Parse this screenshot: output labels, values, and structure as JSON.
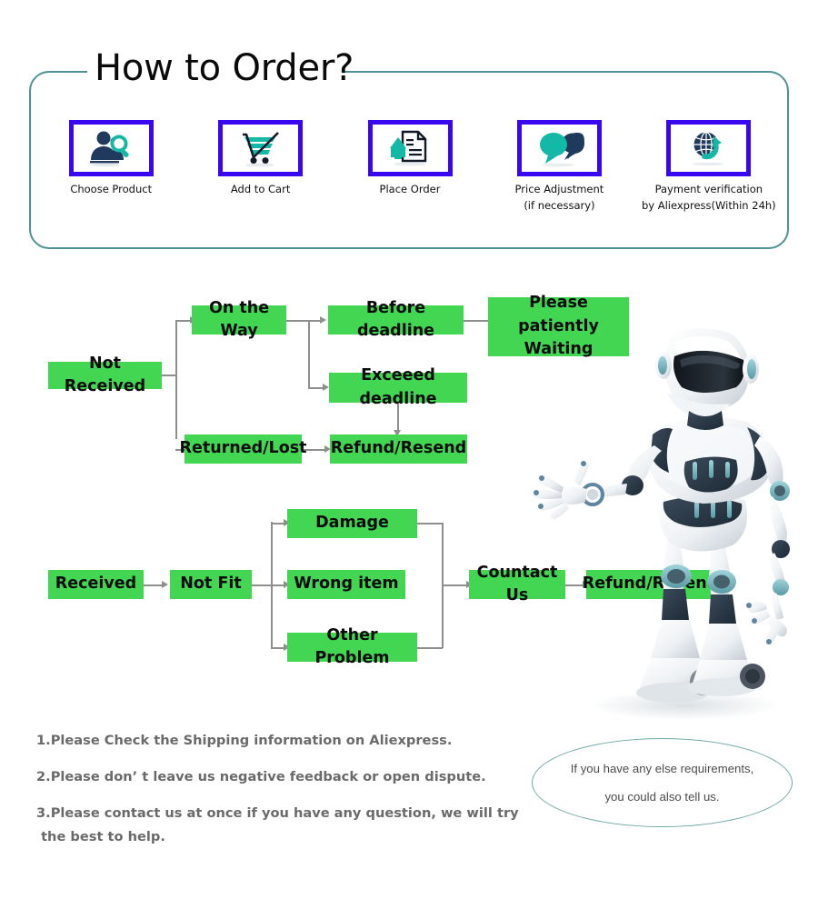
{
  "theme": {
    "frame_teal": "#4f9194",
    "icon_border_blue": "#3a05ef",
    "flow_green": "#43d653",
    "connector_gray": "#8e8e8e",
    "note_gray": "#6a6a6a",
    "icon_teal": "#14b8a6",
    "icon_navy": "#1f3a5c"
  },
  "header": {
    "title": "How to Order?"
  },
  "steps": [
    {
      "icon": "person-search-icon",
      "label": "Choose  Product",
      "sub": ""
    },
    {
      "icon": "shopping-cart-icon",
      "label": "Add to Cart",
      "sub": ""
    },
    {
      "icon": "document-upload-icon",
      "label": "Place  Order",
      "sub": ""
    },
    {
      "icon": "speech-bubbles-icon",
      "label": "Price Adjustment",
      "sub": "(if necessary)"
    },
    {
      "icon": "globe-refresh-icon",
      "label": "Payment verification",
      "sub": "by Aliexpress(Within 24h)"
    }
  ],
  "flow_not_received": {
    "boxes": {
      "not_received": "Not Received",
      "on_the_way": "On the Way",
      "before_deadline": "Before deadline",
      "please_wait": "Please patiently\nWaiting",
      "exceed_deadline": "Exceeed deadline",
      "returned_lost": "Returned/Lost",
      "refund_resend": "Refund/Resend"
    }
  },
  "flow_received": {
    "boxes": {
      "received": "Received",
      "not_fit": "Not Fit",
      "damage": "Damage",
      "wrong_item": "Wrong item",
      "other_problem": "Other Problem",
      "contact_us": "Countact Us",
      "refund_resend": "Refund/Resend"
    }
  },
  "notes": [
    "1.Please Check the Shipping information on Aliexpress.",
    "2.Please don’ t leave us negative feedback or open dispute.",
    "3.Please contact us at once if you have any question, we will try",
    " the best to help."
  ],
  "bubble": {
    "line1": "If you have any else requirements,",
    "line2": "you could also tell us."
  }
}
